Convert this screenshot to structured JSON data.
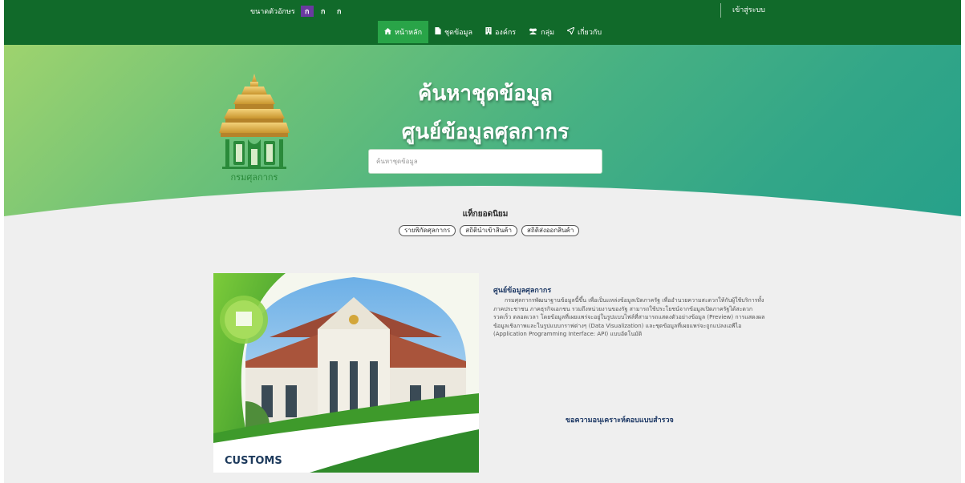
{
  "topbar": {
    "font_size_label": "ขนาดตัวอักษร",
    "font_size_options": [
      "ก",
      "ก",
      "ก"
    ],
    "login_label": "เข้าสู่ระบบ"
  },
  "nav": {
    "items": [
      {
        "label": "หน้าหลัก",
        "icon": "home-icon"
      },
      {
        "label": "ชุดข้อมูล",
        "icon": "file-icon"
      },
      {
        "label": "องค์กร",
        "icon": "building-icon"
      },
      {
        "label": "กลุ่ม",
        "icon": "group-icon"
      },
      {
        "label": "เกี่ยวกับ",
        "icon": "send-icon"
      }
    ]
  },
  "hero": {
    "title_line1": "ค้นหาชุดข้อมูล",
    "title_line2": "ศูนย์ข้อมูลศุลกากร",
    "search_placeholder": "ค้นหาชุดข้อมูล",
    "popular_title": "แท็กยอดนิยม",
    "tags": [
      "รายพิกัดศุลกากร",
      "สถิตินำเข้าสินค้า",
      "สถิติส่งออกสินค้า"
    ],
    "logo_text": "กรมศุลกากร"
  },
  "about": {
    "title": "ศูนย์ข้อมูลศุลกากร",
    "body": "กรมศุลกากรพัฒนาฐานข้อมูลนี้ขึ้น เพื่อเป็นแหล่งข้อมูลเปิดภาครัฐ เพื่ออำนวยความสะดวกให้กับผู้ใช้บริการทั้งภาคประชาชน ภาคธุรกิจเอกชน รวมถึงหน่วยงานของรัฐ สามารถใช้ประโยชน์จากข้อมูลเปิดภาครัฐได้สะดวก รวดเร็ว ตลอดเวลา โดยข้อมูลที่เผยแพร่จะอยู่ในรูปแบบไฟล์ที่สามารถแสดงตัวอย่างข้อมูล (Preview) การแสดงผลข้อมูลเชิงภาพและในรูปแบบกราฟต่างๆ (Data Visualization) และชุดข้อมูลที่เผยแพร่จะถูกแปลงเอพีไอ (Application Programming Interface: API) แบบอัตโนมัติ",
    "survey_link": "ขอความอนุเคราะห์ตอบแบบสำรวจ",
    "photo_caption": "CUSTOMS"
  },
  "colors": {
    "topbar": "#116a2a",
    "nav_active": "#29a448",
    "font_size_active": "#6a3aa0",
    "hero_start": "#9ed36e",
    "hero_end": "#25a08a",
    "page_bg": "#efefef",
    "heading_blue": "#1f3a66"
  }
}
